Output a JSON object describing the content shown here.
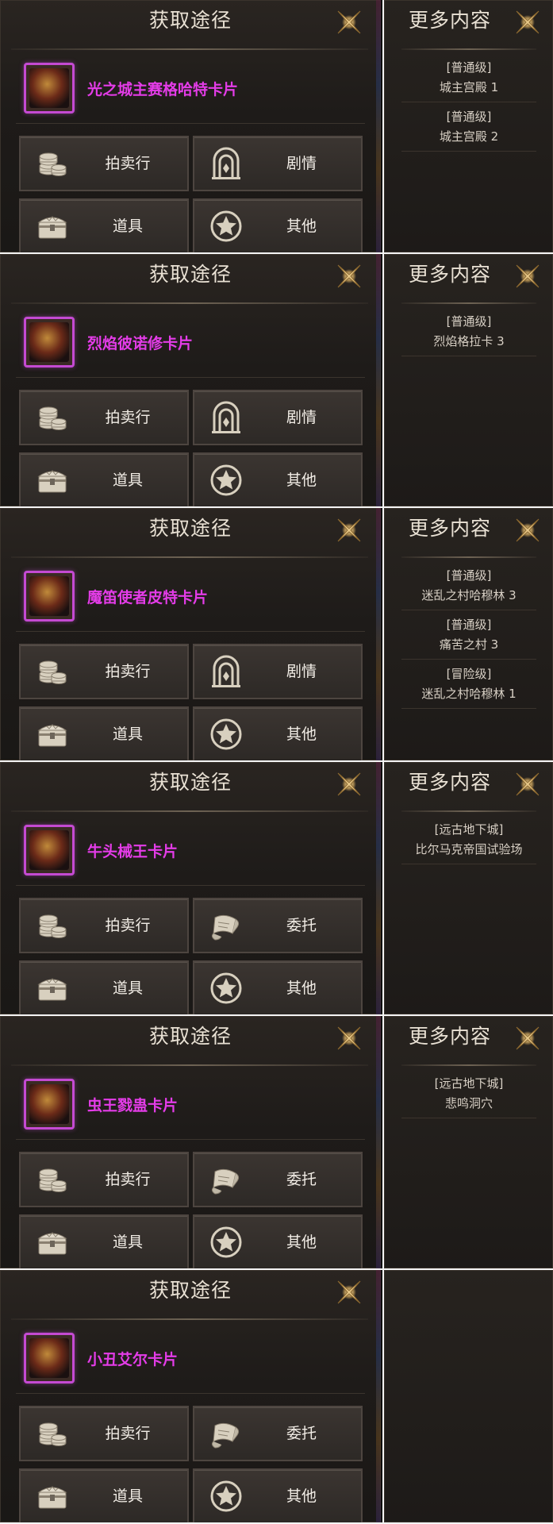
{
  "panels": [
    {
      "title": "获取途径",
      "card_name": "光之城主赛格哈特卡片",
      "buttons": [
        "拍卖行",
        "剧情",
        "道具",
        "其他"
      ],
      "button_icons": [
        "coins-icon",
        "gate-icon",
        "chest-icon",
        "star-icon"
      ],
      "side_title": "更多内容",
      "stages": [
        {
          "level": "[普通级]",
          "name": "城主宫殿 1"
        },
        {
          "level": "[普通级]",
          "name": "城主宫殿 2"
        }
      ]
    },
    {
      "title": "获取途径",
      "card_name": "烈焰彼诺修卡片",
      "buttons": [
        "拍卖行",
        "剧情",
        "道具",
        "其他"
      ],
      "button_icons": [
        "coins-icon",
        "gate-icon",
        "chest-icon",
        "star-icon"
      ],
      "side_title": "更多内容",
      "stages": [
        {
          "level": "[普通级]",
          "name": "烈焰格拉卡 3"
        }
      ]
    },
    {
      "title": "获取途径",
      "card_name": "魔笛使者皮特卡片",
      "buttons": [
        "拍卖行",
        "剧情",
        "道具",
        "其他"
      ],
      "button_icons": [
        "coins-icon",
        "gate-icon",
        "chest-icon",
        "star-icon"
      ],
      "side_title": "更多内容",
      "stages": [
        {
          "level": "[普通级]",
          "name": "迷乱之村哈穆林 3"
        },
        {
          "level": "[普通级]",
          "name": "痛苦之村 3"
        },
        {
          "level": "[冒险级]",
          "name": "迷乱之村哈穆林 1"
        }
      ]
    },
    {
      "title": "获取途径",
      "card_name": "牛头械王卡片",
      "buttons": [
        "拍卖行",
        "委托",
        "道具",
        "其他"
      ],
      "button_icons": [
        "coins-icon",
        "scroll-icon",
        "chest-icon",
        "star-icon"
      ],
      "side_title": "更多内容",
      "stages": [
        {
          "level": "[远古地下城]",
          "name": "比尔马克帝国试验场"
        }
      ]
    },
    {
      "title": "获取途径",
      "card_name": "虫王戮蛊卡片",
      "buttons": [
        "拍卖行",
        "委托",
        "道具",
        "其他"
      ],
      "button_icons": [
        "coins-icon",
        "scroll-icon",
        "chest-icon",
        "star-icon"
      ],
      "side_title": "更多内容",
      "stages": [
        {
          "level": "[远古地下城]",
          "name": "悲鸣洞穴"
        }
      ]
    },
    {
      "title": "获取途径",
      "card_name": "小丑艾尔卡片",
      "buttons": [
        "拍卖行",
        "委托",
        "道具",
        "其他"
      ],
      "button_icons": [
        "coins-icon",
        "scroll-icon",
        "chest-icon",
        "star-icon"
      ],
      "side_title": "",
      "stages": []
    }
  ],
  "colors": {
    "card_name": "#e43ce8",
    "card_border": "#c44ad2",
    "panel_bg": "#1e1b19",
    "button_bg": "#332e2b",
    "text": "#f2ede6"
  }
}
